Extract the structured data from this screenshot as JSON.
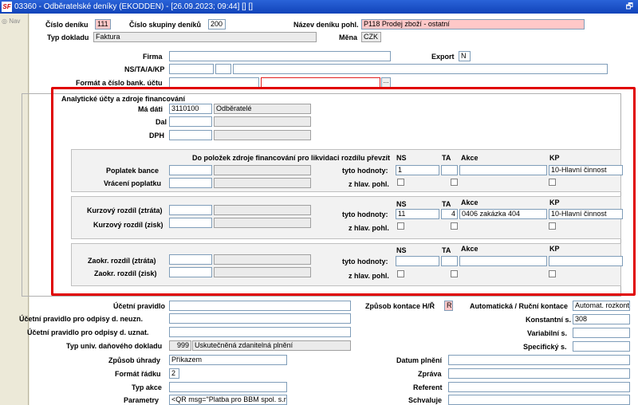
{
  "window": {
    "title": "03360 - Odběratelské deníky (EKODDEN) - [26.09.2023; 09:44]  [] []",
    "app_icon": "SF",
    "restore_icon": "window-restore-icon"
  },
  "nav": {
    "label": "Nav"
  },
  "header": {
    "cislo_deniku_label": "Číslo deníku",
    "cislo_deniku": "111",
    "cislo_skupiny_label": "Číslo skupiny deníků",
    "cislo_skupiny": "200",
    "nazev_deniku_label": "Název deníku pohl.",
    "nazev_deniku": "P118 Prodej zboží - ostatní",
    "typ_dokladu_label": "Typ dokladu",
    "typ_dokladu": "Faktura",
    "mena_label": "Měna",
    "mena": "CZK",
    "firma_label": "Firma",
    "firma": "",
    "export_label": "Export",
    "export": "N",
    "ns_label": "NS/TA/A/KP",
    "format_label": "Formát a číslo bank. účtu",
    "ellipsis": "..."
  },
  "analytic": {
    "group_label": "Analytické účty a zdroje financování",
    "ma_dati_label": "Má dáti",
    "ma_dati_code": "3110100",
    "ma_dati_name": "Odběratelé",
    "dal_label": "Dal",
    "dph_label": "DPH",
    "section1": {
      "heading": "Do položek zdroje financování pro likvidaci rozdílu převzít",
      "ns_col": "NS",
      "ta_col": "TA",
      "akce_col": "Akce",
      "kp_col": "KP",
      "poplatek_label": "Poplatek bance",
      "vraceni_label": "Vrácení poplatku",
      "tyto_label": "tyto hodnoty:",
      "zhlav_label": "z hlav. pohl.",
      "ns": "1",
      "ta": "",
      "akce": "",
      "kp": "10-Hlavní činnost"
    },
    "section2": {
      "ns_col": "NS",
      "ta_col": "TA",
      "akce_col": "Akce",
      "kp_col": "KP",
      "ztrata_label": "Kurzový rozdíl (ztráta)",
      "zisk_label": "Kurzový rozdíl (zisk)",
      "tyto_label": "tyto hodnoty:",
      "zhlav_label": "z hlav. pohl.",
      "ns": "11",
      "ta": "4",
      "akce": "0406 zakázka 404",
      "kp": "10-Hlavní činnost"
    },
    "section3": {
      "ns_col": "NS",
      "ta_col": "TA",
      "akce_col": "Akce",
      "kp_col": "KP",
      "ztrata_label": "Zaokr. rozdíl (ztráta)",
      "zisk_label": "Zaokr. rozdíl (zisk)",
      "tyto_label": "tyto hodnoty:",
      "zhlav_label": "z hlav. pohl.",
      "ns": "",
      "ta": "",
      "akce": "",
      "kp": ""
    }
  },
  "bottom": {
    "ucetni_pravidlo_label": "Účetní pravidlo",
    "odpisy_neuzn_label": "Účetní pravidlo pro odpisy d. neuzn.",
    "odpisy_uzn_label": "Účetní pravidlo pro odpisy d. uznat.",
    "typ_univ_label": "Typ univ. daňového dokladu",
    "typ_univ_code": "999",
    "typ_univ_name": "Uskutečněná zdanitelná plnění",
    "zpusob_uhrady_label": "Způsob úhrady",
    "zpusob_uhrady": "Příkazem",
    "format_radku_label": "Formát řádku",
    "format_radku": "2",
    "typ_akce_label": "Typ akce",
    "parametry_label": "Parametry",
    "parametry": "<QR msg=\"Platba pro BBM spol. s.r.o.\"",
    "zpusob_kontace_label": "Způsob kontace H/Ř",
    "zpusob_kontace": "R",
    "auto_kontace_label": "Automatická / Ruční kontace",
    "auto_kontace": "Automat. rozkontace",
    "konstantni_label": "Konstantní s.",
    "konstantni": "308",
    "variabilni_label": "Variabilní s.",
    "specificky_label": "Specifický s.",
    "datum_plneni_label": "Datum plnění",
    "zprava_label": "Zpráva",
    "referent_label": "Referent",
    "schvaluje_label": "Schvaluje"
  }
}
